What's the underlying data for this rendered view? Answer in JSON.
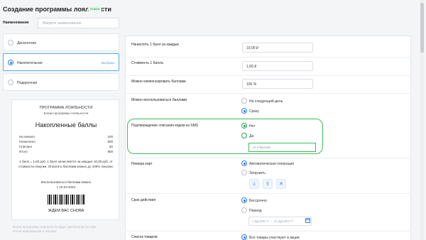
{
  "header": {
    "title": "Создание программы лояльности",
    "badge": "Новая"
  },
  "name_field": {
    "label": "Наименование",
    "placeholder": "Введите наименование"
  },
  "program_types": [
    {
      "label": "Дисконтная"
    },
    {
      "label": "Накопительная",
      "hint": "Выбрано"
    },
    {
      "label": "Подарочная"
    }
  ],
  "preview": {
    "title": "ПРОГРАММА ЛОЯЛЬНОСТИ",
    "subtitle": "Бланк программы лояльности",
    "heading": "Накопленные баллы",
    "rows": [
      {
        "label": "На начало",
        "value": "100"
      },
      {
        "label": "Начислено",
        "value": "500"
      },
      {
        "label": "Списано",
        "value": "50"
      },
      {
        "label": "Итого",
        "value": "550"
      }
    ],
    "desc": "1 балл = 1,00 руб. 1 балл начисляется за каждые 10,00 руб. от стоимости покупки. Оплатить баллами можно до 100% покупки.",
    "use_line1": "Воспользоваться баллами можно",
    "use_line2": "с 16.03.2023",
    "barcode_text": "ЖДЕМ ВАС СНОВА",
    "footnote": "Бланк программы лояльности будет распечатан на чеке после информации о покупке"
  },
  "settings": {
    "accrue": {
      "label": "Начислять 1 балл за каждые",
      "value": "10,00 ₽"
    },
    "cost": {
      "label": "Стоимость 1 балла",
      "value": "1,00 ₽"
    },
    "compensate": {
      "label": "Можно компенсировать баллами",
      "value": "100 %"
    },
    "usage": {
      "label": "Можно воспользоваться баллами",
      "opt1": "На следующий день",
      "opt2": "Сразу"
    },
    "sms": {
      "label": "Подтверждение списания кодом из SMS",
      "opt_no": "Нет",
      "opt_yes": "Да",
      "from_placeholder": "от 0 баллов"
    },
    "cards": {
      "label": "Номера карт",
      "opt1": "Автоматическая генерация",
      "opt2": "Загрузить"
    },
    "validity": {
      "label": "Срок действия",
      "opt1": "Бессрочно",
      "opt2": "Период",
      "date_from": "с ДД.ММ.ГГ",
      "date_to": "по ДД.ММ.ГГ"
    },
    "goods": {
      "label": "Список товаров",
      "opt1": "Все товары участвуют в акции"
    }
  },
  "colors": {
    "accent_blue": "#2a7de1",
    "highlight_green": "#3bbd5a"
  }
}
